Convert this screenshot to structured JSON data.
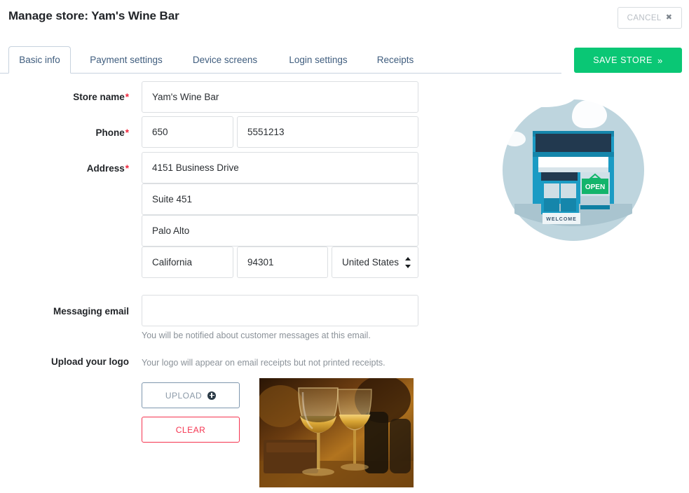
{
  "header": {
    "title": "Manage store: Yam's Wine Bar",
    "cancel_label": "CANCEL",
    "cancel_icon": "close-x-icon",
    "save_label": "SAVE STORE",
    "save_icon": "double-chevron-right-icon"
  },
  "tabs": [
    {
      "label": "Basic info",
      "active": true
    },
    {
      "label": "Payment settings",
      "active": false
    },
    {
      "label": "Device screens",
      "active": false
    },
    {
      "label": "Login settings",
      "active": false
    },
    {
      "label": "Receipts",
      "active": false
    }
  ],
  "form": {
    "store_name": {
      "label": "Store name",
      "required": "*",
      "value": "Yam's Wine Bar",
      "placeholder": ""
    },
    "phone": {
      "label": "Phone",
      "required": "*",
      "area_code": "650",
      "area_code_placeholder": "",
      "number": "5551213",
      "number_placeholder": ""
    },
    "address": {
      "label": "Address",
      "required": "*",
      "line1": "4151 Business Drive",
      "line1_placeholder": "",
      "line2": "Suite 451",
      "line2_placeholder": "",
      "city": "Palo Alto",
      "city_placeholder": "",
      "state": "California",
      "state_placeholder": "",
      "zip": "94301",
      "zip_placeholder": "",
      "country": "United States",
      "country_options": [
        "United States"
      ]
    },
    "messaging_email": {
      "label": "Messaging email",
      "value": "",
      "placeholder": "",
      "helper": "You will be notified about customer messages at this email."
    },
    "logo": {
      "label": "Upload your logo",
      "helper": "Your logo will appear on email receipts but not printed receipts.",
      "upload_label": "UPLOAD",
      "upload_icon": "plus-circle-icon",
      "clear_label": "CLEAR"
    }
  },
  "illustration": {
    "name": "storefront-illustration",
    "open_sign_text": "OPEN",
    "welcome_mat_text": "WELCOME"
  },
  "colors": {
    "accent_green": "#0ac775",
    "danger_red": "#f5334f",
    "required_red": "#f0263c",
    "tab_blue": "#3f5d7e",
    "border_grey": "#dcdfe2",
    "helper_grey": "#8b9299"
  }
}
